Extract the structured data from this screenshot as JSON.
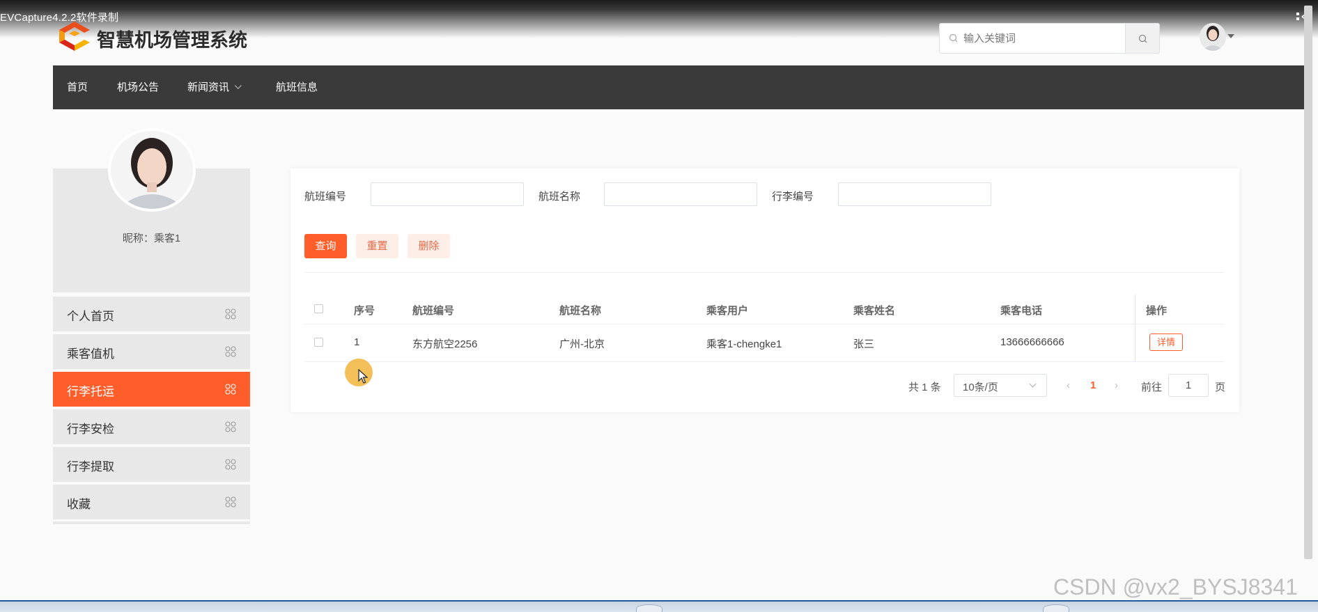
{
  "recording": {
    "title": "EVCapture4.2.2软件录制"
  },
  "header": {
    "site_title": "智慧机场管理系统",
    "search_placeholder": "输入关键词"
  },
  "nav": {
    "items": [
      {
        "label": "首页"
      },
      {
        "label": "机场公告"
      },
      {
        "label": "新闻资讯",
        "has_dropdown": true
      },
      {
        "label": "航班信息"
      }
    ]
  },
  "sidebar": {
    "nickname": "昵称：乘客1",
    "items": [
      {
        "label": "个人首页",
        "active": false
      },
      {
        "label": "乘客值机",
        "active": false
      },
      {
        "label": "行李托运",
        "active": true
      },
      {
        "label": "行李安检",
        "active": false
      },
      {
        "label": "行李提取",
        "active": false
      },
      {
        "label": "收藏",
        "active": false
      }
    ]
  },
  "filters": {
    "flight_no_label": "航班编号",
    "flight_name_label": "航班名称",
    "luggage_no_label": "行李编号"
  },
  "actions": {
    "query": "查询",
    "reset": "重置",
    "delete": "删除"
  },
  "table": {
    "columns": [
      "序号",
      "航班编号",
      "航班名称",
      "乘客用户",
      "乘客姓名",
      "乘客电话",
      "操作"
    ],
    "rows": [
      {
        "index": "1",
        "flight_no": "东方航空2256",
        "flight_name": "广州-北京",
        "user": "乘客1-chengke1",
        "name": "张三",
        "phone": "13666666666",
        "action": "详情"
      }
    ]
  },
  "pagination": {
    "total": "共 1 条",
    "page_size": "10条/页",
    "current": "1",
    "goto_label": "前往",
    "goto_value": "1",
    "page_suffix": "页"
  },
  "watermark": "CSDN @vx2_BYSJ8341",
  "colors": {
    "accent": "#ff5d2a",
    "nav_bg": "#3a3a3a",
    "sidebar_bg": "#e8e8e8"
  }
}
